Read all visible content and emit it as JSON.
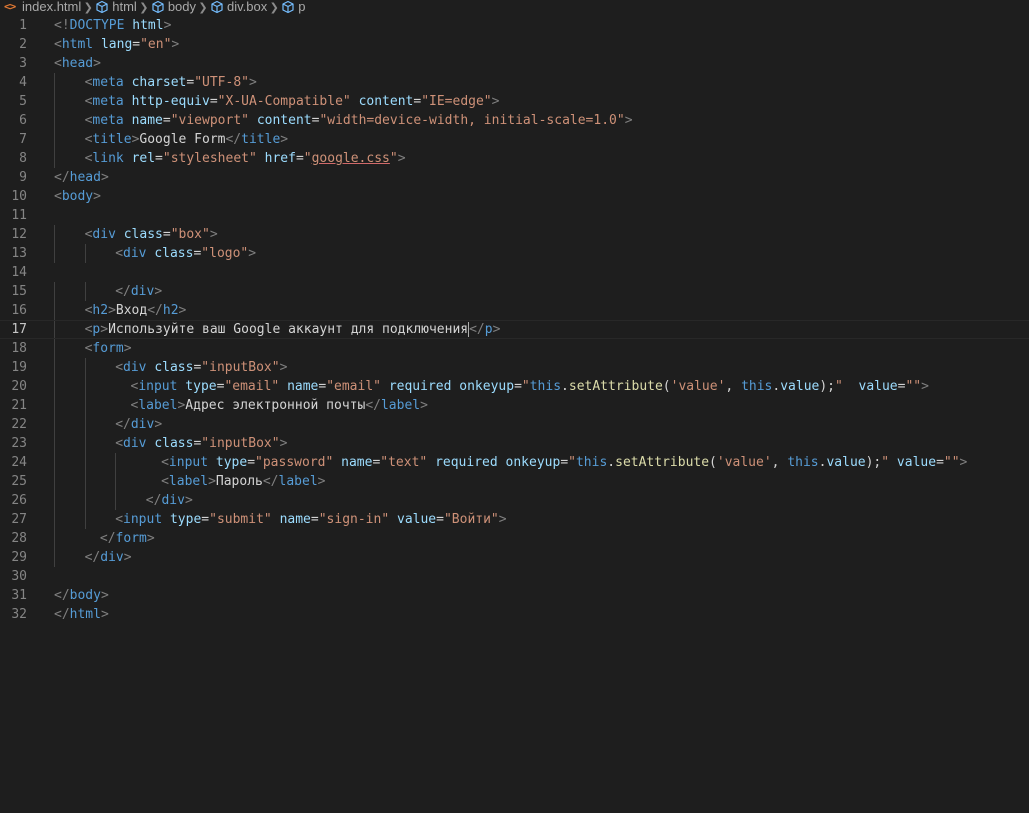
{
  "breadcrumb": {
    "file": "index.html",
    "items": [
      "html",
      "body",
      "div.box",
      "p"
    ],
    "file_icon": "<>"
  },
  "colors": {
    "background": "#1e1e1e",
    "tag": "#569cd6",
    "attribute": "#9cdcfe",
    "string": "#ce9178",
    "text": "#d4d4d4",
    "line_number": "#858585",
    "file_icon": "#e37933"
  },
  "editor": {
    "current_line": 17,
    "lines": [
      {
        "n": "1",
        "indent": 0,
        "tokens": [
          [
            "p",
            "<!"
          ],
          [
            "t",
            "DOCTYPE"
          ],
          [
            "x",
            " "
          ],
          [
            "a",
            "html"
          ],
          [
            "p",
            ">"
          ]
        ]
      },
      {
        "n": "2",
        "indent": 0,
        "tokens": [
          [
            "p",
            "<"
          ],
          [
            "t",
            "html"
          ],
          [
            "x",
            " "
          ],
          [
            "a",
            "lang"
          ],
          [
            "x",
            "="
          ],
          [
            "s",
            "\"en\""
          ],
          [
            "p",
            ">"
          ]
        ]
      },
      {
        "n": "3",
        "indent": 0,
        "tokens": [
          [
            "p",
            "<"
          ],
          [
            "t",
            "head"
          ],
          [
            "p",
            ">"
          ]
        ]
      },
      {
        "n": "4",
        "indent": 1,
        "tokens": [
          [
            "p",
            "<"
          ],
          [
            "t",
            "meta"
          ],
          [
            "x",
            " "
          ],
          [
            "a",
            "charset"
          ],
          [
            "x",
            "="
          ],
          [
            "s",
            "\"UTF-8\""
          ],
          [
            "p",
            ">"
          ]
        ]
      },
      {
        "n": "5",
        "indent": 1,
        "tokens": [
          [
            "p",
            "<"
          ],
          [
            "t",
            "meta"
          ],
          [
            "x",
            " "
          ],
          [
            "a",
            "http-equiv"
          ],
          [
            "x",
            "="
          ],
          [
            "s",
            "\"X-UA-Compatible\""
          ],
          [
            "x",
            " "
          ],
          [
            "a",
            "content"
          ],
          [
            "x",
            "="
          ],
          [
            "s",
            "\"IE=edge\""
          ],
          [
            "p",
            ">"
          ]
        ]
      },
      {
        "n": "6",
        "indent": 1,
        "tokens": [
          [
            "p",
            "<"
          ],
          [
            "t",
            "meta"
          ],
          [
            "x",
            " "
          ],
          [
            "a",
            "name"
          ],
          [
            "x",
            "="
          ],
          [
            "s",
            "\"viewport\""
          ],
          [
            "x",
            " "
          ],
          [
            "a",
            "content"
          ],
          [
            "x",
            "="
          ],
          [
            "s",
            "\"width=device-width, initial-scale=1.0\""
          ],
          [
            "p",
            ">"
          ]
        ]
      },
      {
        "n": "7",
        "indent": 1,
        "tokens": [
          [
            "p",
            "<"
          ],
          [
            "t",
            "title"
          ],
          [
            "p",
            ">"
          ],
          [
            "x",
            "Google Form"
          ],
          [
            "p",
            "</"
          ],
          [
            "t",
            "title"
          ],
          [
            "p",
            ">"
          ]
        ]
      },
      {
        "n": "8",
        "indent": 1,
        "tokens": [
          [
            "p",
            "<"
          ],
          [
            "t",
            "link"
          ],
          [
            "x",
            " "
          ],
          [
            "a",
            "rel"
          ],
          [
            "x",
            "="
          ],
          [
            "s",
            "\"stylesheet\""
          ],
          [
            "x",
            " "
          ],
          [
            "a",
            "href"
          ],
          [
            "x",
            "="
          ],
          [
            "s",
            "\""
          ],
          [
            "u",
            "google.css"
          ],
          [
            "s",
            "\""
          ],
          [
            "p",
            ">"
          ]
        ]
      },
      {
        "n": "9",
        "indent": 0,
        "tokens": [
          [
            "p",
            "</"
          ],
          [
            "t",
            "head"
          ],
          [
            "p",
            ">"
          ]
        ]
      },
      {
        "n": "10",
        "indent": 0,
        "tokens": [
          [
            "p",
            "<"
          ],
          [
            "t",
            "body"
          ],
          [
            "p",
            ">"
          ]
        ]
      },
      {
        "n": "11",
        "indent": 0,
        "tokens": []
      },
      {
        "n": "12",
        "indent": 1,
        "tokens": [
          [
            "p",
            "<"
          ],
          [
            "t",
            "div"
          ],
          [
            "x",
            " "
          ],
          [
            "a",
            "class"
          ],
          [
            "x",
            "="
          ],
          [
            "s",
            "\"box\""
          ],
          [
            "p",
            ">"
          ]
        ]
      },
      {
        "n": "13",
        "indent": 2,
        "tokens": [
          [
            "p",
            "<"
          ],
          [
            "t",
            "div"
          ],
          [
            "x",
            " "
          ],
          [
            "a",
            "class"
          ],
          [
            "x",
            "="
          ],
          [
            "s",
            "\"logo\""
          ],
          [
            "p",
            ">"
          ]
        ]
      },
      {
        "n": "14",
        "indent": 0,
        "tokens": []
      },
      {
        "n": "15",
        "indent": 2,
        "tokens": [
          [
            "p",
            "</"
          ],
          [
            "t",
            "div"
          ],
          [
            "p",
            ">"
          ]
        ]
      },
      {
        "n": "16",
        "indent": 1,
        "tokens": [
          [
            "p",
            "<"
          ],
          [
            "t",
            "h2"
          ],
          [
            "p",
            ">"
          ],
          [
            "x",
            "Вход"
          ],
          [
            "p",
            "</"
          ],
          [
            "t",
            "h2"
          ],
          [
            "p",
            ">"
          ]
        ]
      },
      {
        "n": "17",
        "indent": 1,
        "tokens": [
          [
            "p",
            "<"
          ],
          [
            "t",
            "p"
          ],
          [
            "p",
            ">"
          ],
          [
            "x",
            "Используйте ваш Google аккаунт для подключения"
          ],
          [
            "c",
            ""
          ],
          [
            "p",
            "</"
          ],
          [
            "t",
            "p"
          ],
          [
            "p",
            ">"
          ]
        ]
      },
      {
        "n": "18",
        "indent": 1,
        "tokens": [
          [
            "p",
            "<"
          ],
          [
            "t",
            "form"
          ],
          [
            "p",
            ">"
          ]
        ]
      },
      {
        "n": "19",
        "indent": 2,
        "tokens": [
          [
            "p",
            "<"
          ],
          [
            "t",
            "div"
          ],
          [
            "x",
            " "
          ],
          [
            "a",
            "class"
          ],
          [
            "x",
            "="
          ],
          [
            "s",
            "\"inputBox\""
          ],
          [
            "p",
            ">"
          ]
        ]
      },
      {
        "n": "20",
        "indent": 2,
        "extra": "  ",
        "tokens": [
          [
            "p",
            "<"
          ],
          [
            "t",
            "input"
          ],
          [
            "x",
            " "
          ],
          [
            "a",
            "type"
          ],
          [
            "x",
            "="
          ],
          [
            "s",
            "\"email\""
          ],
          [
            "x",
            " "
          ],
          [
            "a",
            "name"
          ],
          [
            "x",
            "="
          ],
          [
            "s",
            "\"email\""
          ],
          [
            "x",
            " "
          ],
          [
            "a",
            "required"
          ],
          [
            "x",
            " "
          ],
          [
            "a",
            "onkeyup"
          ],
          [
            "x",
            "="
          ],
          [
            "s",
            "\""
          ],
          [
            "k",
            "this"
          ],
          [
            "x",
            "."
          ],
          [
            "j",
            "setAttribute"
          ],
          [
            "x",
            "("
          ],
          [
            "s",
            "'value'"
          ],
          [
            "x",
            ", "
          ],
          [
            "k",
            "this"
          ],
          [
            "x",
            "."
          ],
          [
            "a",
            "value"
          ],
          [
            "x",
            ");"
          ],
          [
            "s",
            "\""
          ],
          [
            "x",
            "  "
          ],
          [
            "a",
            "value"
          ],
          [
            "x",
            "="
          ],
          [
            "s",
            "\"\""
          ],
          [
            "p",
            ">"
          ]
        ]
      },
      {
        "n": "21",
        "indent": 2,
        "extra": "  ",
        "tokens": [
          [
            "p",
            "<"
          ],
          [
            "t",
            "label"
          ],
          [
            "p",
            ">"
          ],
          [
            "x",
            "Адрес электронной почты"
          ],
          [
            "p",
            "</"
          ],
          [
            "t",
            "label"
          ],
          [
            "p",
            ">"
          ]
        ]
      },
      {
        "n": "22",
        "indent": 2,
        "tokens": [
          [
            "p",
            "</"
          ],
          [
            "t",
            "div"
          ],
          [
            "p",
            ">"
          ]
        ]
      },
      {
        "n": "23",
        "indent": 2,
        "tokens": [
          [
            "p",
            "<"
          ],
          [
            "t",
            "div"
          ],
          [
            "x",
            " "
          ],
          [
            "a",
            "class"
          ],
          [
            "x",
            "="
          ],
          [
            "s",
            "\"inputBox\""
          ],
          [
            "p",
            ">"
          ]
        ]
      },
      {
        "n": "24",
        "indent": 3,
        "extra": "  ",
        "tokens": [
          [
            "p",
            "<"
          ],
          [
            "t",
            "input"
          ],
          [
            "x",
            " "
          ],
          [
            "a",
            "type"
          ],
          [
            "x",
            "="
          ],
          [
            "s",
            "\"password\""
          ],
          [
            "x",
            " "
          ],
          [
            "a",
            "name"
          ],
          [
            "x",
            "="
          ],
          [
            "s",
            "\"text\""
          ],
          [
            "x",
            " "
          ],
          [
            "a",
            "required"
          ],
          [
            "x",
            " "
          ],
          [
            "a",
            "onkeyup"
          ],
          [
            "x",
            "="
          ],
          [
            "s",
            "\""
          ],
          [
            "k",
            "this"
          ],
          [
            "x",
            "."
          ],
          [
            "j",
            "setAttribute"
          ],
          [
            "x",
            "("
          ],
          [
            "s",
            "'value'"
          ],
          [
            "x",
            ", "
          ],
          [
            "k",
            "this"
          ],
          [
            "x",
            "."
          ],
          [
            "a",
            "value"
          ],
          [
            "x",
            ");"
          ],
          [
            "s",
            "\""
          ],
          [
            "x",
            " "
          ],
          [
            "a",
            "value"
          ],
          [
            "x",
            "="
          ],
          [
            "s",
            "\"\""
          ],
          [
            "p",
            ">"
          ]
        ]
      },
      {
        "n": "25",
        "indent": 3,
        "extra": "  ",
        "tokens": [
          [
            "p",
            "<"
          ],
          [
            "t",
            "label"
          ],
          [
            "p",
            ">"
          ],
          [
            "x",
            "Пароль"
          ],
          [
            "p",
            "</"
          ],
          [
            "t",
            "label"
          ],
          [
            "p",
            ">"
          ]
        ]
      },
      {
        "n": "26",
        "indent": 3,
        "tokens": [
          [
            "p",
            "</"
          ],
          [
            "t",
            "div"
          ],
          [
            "p",
            ">"
          ]
        ]
      },
      {
        "n": "27",
        "indent": 2,
        "tokens": [
          [
            "p",
            "<"
          ],
          [
            "t",
            "input"
          ],
          [
            "x",
            " "
          ],
          [
            "a",
            "type"
          ],
          [
            "x",
            "="
          ],
          [
            "s",
            "\"submit\""
          ],
          [
            "x",
            " "
          ],
          [
            "a",
            "name"
          ],
          [
            "x",
            "="
          ],
          [
            "s",
            "\"sign-in\""
          ],
          [
            "x",
            " "
          ],
          [
            "a",
            "value"
          ],
          [
            "x",
            "="
          ],
          [
            "s",
            "\"Войти\""
          ],
          [
            "p",
            ">"
          ]
        ]
      },
      {
        "n": "28",
        "indent": 1,
        "extra": "  ",
        "tokens": [
          [
            "p",
            "</"
          ],
          [
            "t",
            "form"
          ],
          [
            "p",
            ">"
          ]
        ]
      },
      {
        "n": "29",
        "indent": 1,
        "tokens": [
          [
            "p",
            "</"
          ],
          [
            "t",
            "div"
          ],
          [
            "p",
            ">"
          ]
        ]
      },
      {
        "n": "30",
        "indent": 0,
        "tokens": []
      },
      {
        "n": "31",
        "indent": 0,
        "tokens": [
          [
            "p",
            "</"
          ],
          [
            "t",
            "body"
          ],
          [
            "p",
            ">"
          ]
        ]
      },
      {
        "n": "32",
        "indent": 0,
        "tokens": [
          [
            "p",
            "</"
          ],
          [
            "t",
            "html"
          ],
          [
            "p",
            ">"
          ]
        ]
      }
    ]
  }
}
